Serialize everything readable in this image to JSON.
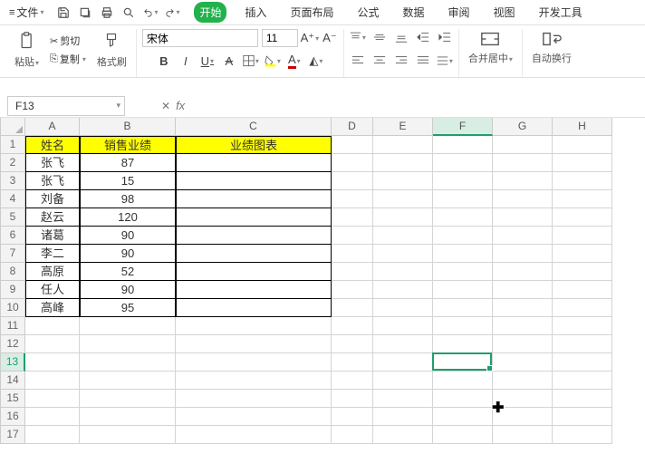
{
  "menu": {
    "file": "文件",
    "tabs": [
      "开始",
      "插入",
      "页面布局",
      "公式",
      "数据",
      "审阅",
      "视图",
      "开发工具"
    ],
    "active_tab_index": 0
  },
  "ribbon": {
    "clipboard": {
      "paste": "粘贴",
      "cut": "剪切",
      "copy": "复制",
      "format_painter": "格式刷"
    },
    "font": {
      "name": "宋体",
      "size": "11"
    },
    "merge": "合并居中",
    "wrap": "自动换行"
  },
  "namebox": "F13",
  "columns": [
    {
      "id": "A",
      "w": 60
    },
    {
      "id": "B",
      "w": 106
    },
    {
      "id": "C",
      "w": 172
    },
    {
      "id": "D",
      "w": 46
    },
    {
      "id": "E",
      "w": 66
    },
    {
      "id": "F",
      "w": 66
    },
    {
      "id": "G",
      "w": 66
    },
    {
      "id": "H",
      "w": 66
    }
  ],
  "selected": {
    "col": "F",
    "row": 13
  },
  "header_row": {
    "A": "姓名",
    "B": "销售业绩",
    "C": "业绩图表"
  },
  "data_rows": [
    {
      "A": "张飞",
      "B": "87"
    },
    {
      "A": "张飞",
      "B": "15"
    },
    {
      "A": "刘备",
      "B": "98"
    },
    {
      "A": "赵云",
      "B": "120"
    },
    {
      "A": "诸葛",
      "B": "90"
    },
    {
      "A": "李二",
      "B": "90"
    },
    {
      "A": "高原",
      "B": "52"
    },
    {
      "A": "任人",
      "B": "90"
    },
    {
      "A": "高峰",
      "B": "95"
    }
  ],
  "total_rows": 17,
  "chart_data": {
    "type": "table",
    "title": "业绩图表",
    "columns": [
      "姓名",
      "销售业绩"
    ],
    "rows": [
      [
        "张飞",
        87
      ],
      [
        "张飞",
        15
      ],
      [
        "刘备",
        98
      ],
      [
        "赵云",
        120
      ],
      [
        "诸葛",
        90
      ],
      [
        "李二",
        90
      ],
      [
        "高原",
        52
      ],
      [
        "任人",
        90
      ],
      [
        "高峰",
        95
      ]
    ]
  }
}
